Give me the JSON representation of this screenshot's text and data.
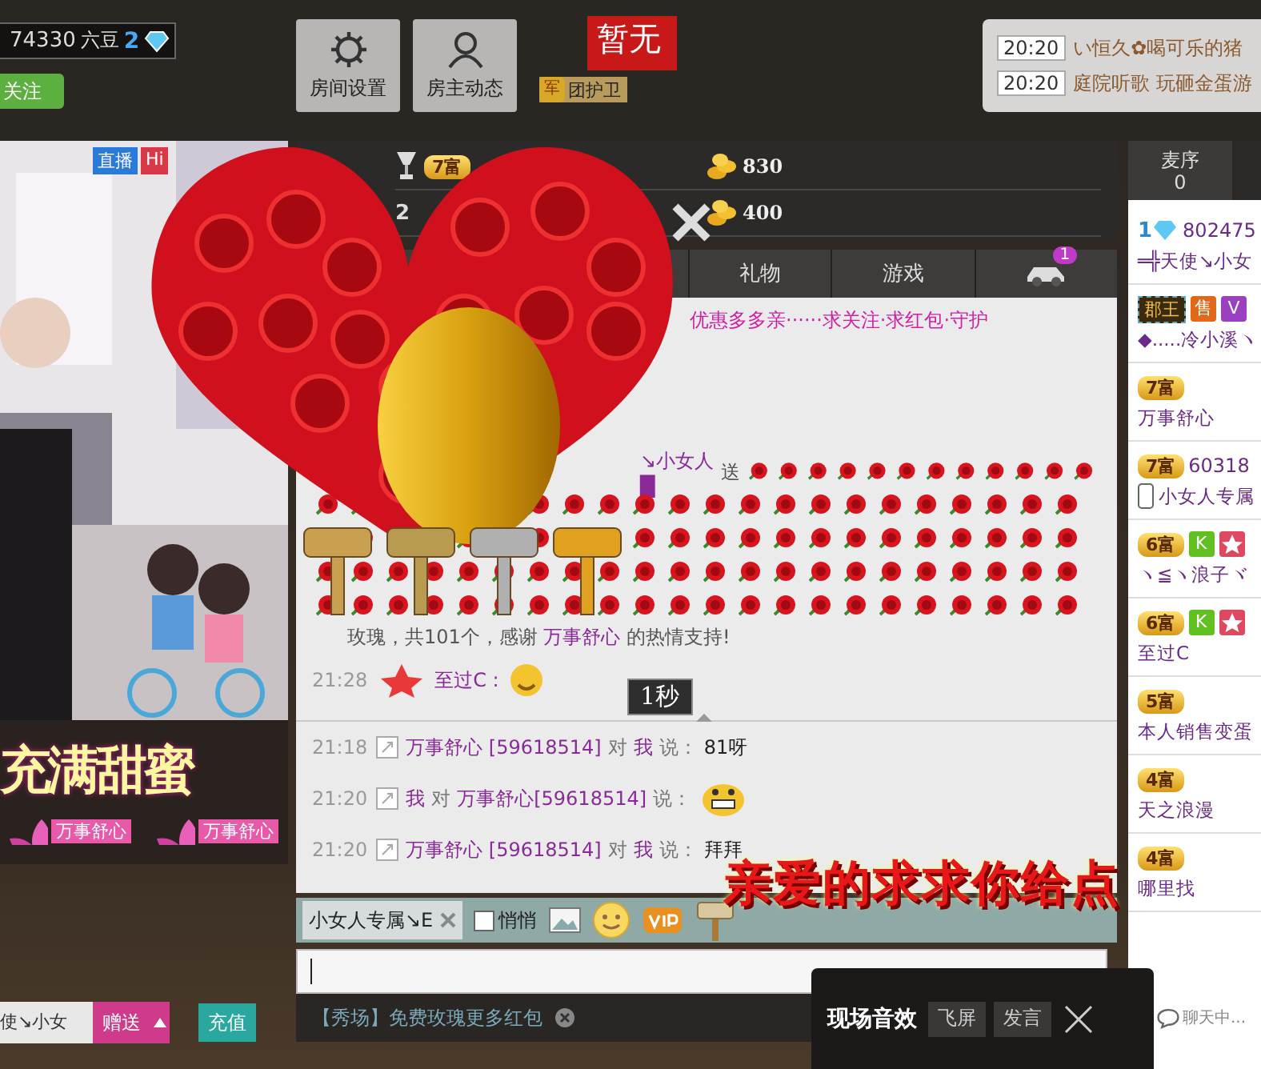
{
  "header": {
    "stats": {
      "beans": "74330",
      "beans_label": "六豆",
      "level": "2"
    },
    "follow_button": "关注",
    "buttons": [
      {
        "kind": "settings",
        "label": "房间设置"
      },
      {
        "kind": "person",
        "label": "房主动态"
      }
    ],
    "flag": "暂无",
    "guard_badge": {
      "icon_text": "军",
      "label": "团护卫"
    },
    "notices": [
      {
        "time": "20:20",
        "text": "い恒久✿喝可乐的猪"
      },
      {
        "time": "20:20",
        "text": "庭院听歌 玩砸金蛋游"
      }
    ]
  },
  "video": {
    "badges": [
      "直播",
      "Hi"
    ],
    "banner": {
      "title": "充满甜蜜",
      "names": [
        "万事舒心",
        "万事舒心"
      ]
    }
  },
  "rank": [
    {
      "kind": "trophy",
      "badge": "7富",
      "value": "830"
    },
    {
      "kind": "number",
      "rank": "2",
      "value": "400"
    }
  ],
  "tabs": [
    {
      "kind": "text",
      "label": "礼物"
    },
    {
      "kind": "text",
      "label": "游戏"
    },
    {
      "kind": "car",
      "badge": "1"
    }
  ],
  "chat": {
    "announcement": "优惠多多亲······求关注·求红包·守护",
    "gift": {
      "sender": "↘小女人█",
      "verb": "送",
      "thanks_before": "玫瑰，共101个，感谢",
      "thanks_name": "万事舒心",
      "thanks_after": "的热情支持!"
    },
    "public": [
      {
        "time": "21:28",
        "user": "至过C :"
      }
    ],
    "tooltip": "1秒",
    "private": [
      {
        "time": "21:18",
        "segments": [
          {
            "kind": "name",
            "text": "万事舒心 [59618514]"
          },
          {
            "kind": "plain",
            "text": "对"
          },
          {
            "kind": "name",
            "text": "我"
          },
          {
            "kind": "plain",
            "text": "说："
          },
          {
            "kind": "text",
            "text": "81呀"
          }
        ]
      },
      {
        "time": "21:20",
        "segments": [
          {
            "kind": "name",
            "text": "我"
          },
          {
            "kind": "plain",
            "text": "对"
          },
          {
            "kind": "name",
            "text": "万事舒心[59618514]"
          },
          {
            "kind": "plain",
            "text": "说："
          },
          {
            "kind": "emoji"
          }
        ]
      },
      {
        "time": "21:20",
        "segments": [
          {
            "kind": "name",
            "text": "万事舒心 [59618514]"
          },
          {
            "kind": "plain",
            "text": "对"
          },
          {
            "kind": "name",
            "text": "我"
          },
          {
            "kind": "plain",
            "text": "说："
          },
          {
            "kind": "text",
            "text": "拜拜"
          }
        ]
      }
    ]
  },
  "toolbar": {
    "recipient": "小女人专属↘E",
    "whisper": {
      "label": "悄悄",
      "checked": false
    }
  },
  "promo": "【秀场】免费玫瑰更多红包",
  "overlay_text": "亲爱的求求你给点",
  "right": {
    "tab": {
      "label": "麦序",
      "count": "0"
    },
    "users": [
      {
        "badges": [
          {
            "kind": "diamond",
            "label": "1"
          }
        ],
        "id": "802475",
        "name": "═╬天使↘小女"
      },
      {
        "badges": [
          {
            "kind": "rank",
            "label": "郡王"
          },
          {
            "kind": "sell",
            "label": "售"
          },
          {
            "kind": "v",
            "label": "V"
          }
        ],
        "name": "◆.....冷小溪ヽ"
      },
      {
        "badges": [
          {
            "kind": "rich",
            "label": "7富"
          }
        ],
        "name": "万事舒心"
      },
      {
        "badges": [
          {
            "kind": "rich",
            "label": "7富"
          }
        ],
        "id": "60318",
        "name": "小女人专属",
        "mobile": true
      },
      {
        "badges": [
          {
            "kind": "rich",
            "label": "6富"
          },
          {
            "kind": "k",
            "label": "K"
          },
          {
            "kind": "star"
          }
        ],
        "name": "ヽ≦ヽ浪子ヾ"
      },
      {
        "badges": [
          {
            "kind": "rich",
            "label": "6富"
          },
          {
            "kind": "k",
            "label": "K"
          },
          {
            "kind": "star"
          }
        ],
        "name": "至过C"
      },
      {
        "badges": [
          {
            "kind": "rich",
            "label": "5富"
          }
        ],
        "name": "本人销售变蛋"
      },
      {
        "badges": [
          {
            "kind": "rich",
            "label": "4富"
          }
        ],
        "name": "天之浪漫"
      },
      {
        "badges": [
          {
            "kind": "rich",
            "label": "4富"
          }
        ],
        "name": "哪里找"
      }
    ],
    "chat_status": "聊天中..."
  },
  "gift_bar": {
    "select": "使↘小女",
    "send_button": "赠送",
    "recharge_button": "充值"
  },
  "bottom_buttons": [
    "飞屏",
    "发言"
  ],
  "popup": {
    "title": "现场音效"
  }
}
